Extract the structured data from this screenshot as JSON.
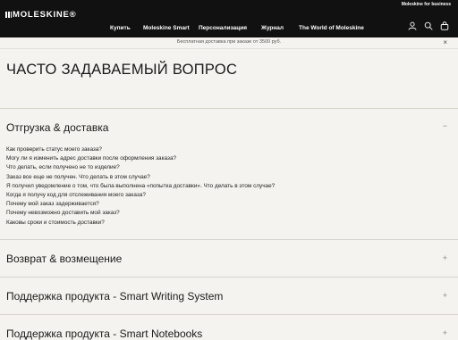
{
  "header": {
    "logo_text": "MOLESKINE®",
    "business_link": "Moleskine for business",
    "nav": [
      "Купить",
      "Moleskine Smart",
      "Персонализация",
      "Журнал",
      "The World of Moleskine"
    ],
    "icons": [
      "user-icon",
      "search-icon",
      "cart-icon"
    ]
  },
  "promo": {
    "text": "Бесплатная доставка при заказе от 3500 руб.",
    "close_label": "×"
  },
  "page": {
    "title": "ЧАСТО ЗАДАВАЕМЫЙ ВОПРОС"
  },
  "faq": {
    "sections": [
      {
        "title": "Отгрузка & доставка",
        "toggle": "−",
        "expanded": true,
        "questions": [
          "Как проверить статус моего заказа?",
          "Могу ли я изменить адрес доставки после оформления заказа?",
          "Что делать, если получено не то изделие?",
          "Заказ все еще не получен. Что делать в этом случае?",
          "Я получил уведомление о том, что была выполнена «попытка доставки». Что делать в этом случае?",
          "Когда я получу код для отслеживания моего заказа?",
          "Почему мой заказ задерживается?",
          "Почему невозможно доставить мой заказ?",
          "Каковы сроки и стоимость доставки?"
        ]
      },
      {
        "title": "Возврат & возмещение",
        "toggle": "+",
        "expanded": false
      },
      {
        "title": "Поддержка продукта - Smart Writing System",
        "toggle": "+",
        "expanded": false
      },
      {
        "title": "Поддержка продукта - Smart Notebooks",
        "toggle": "+",
        "expanded": false
      }
    ]
  },
  "colors": {
    "header_bg": "#111111",
    "page_bg": "#f5f3ef",
    "divider": "#d6d3cc"
  }
}
